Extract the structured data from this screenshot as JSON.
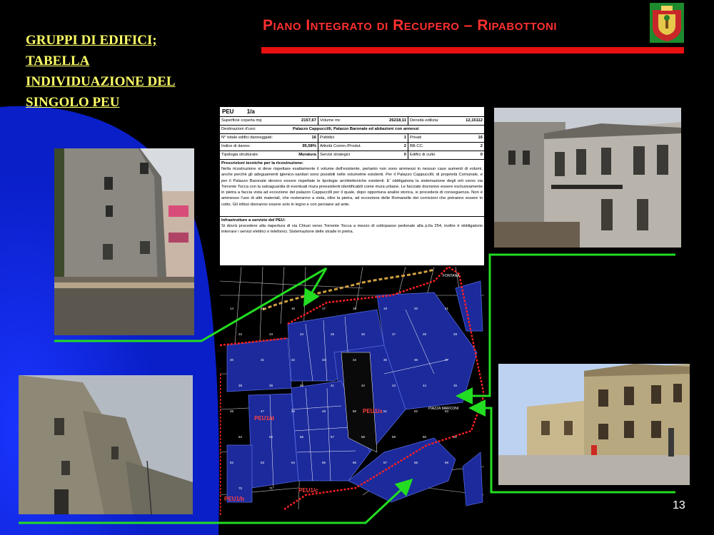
{
  "slide": {
    "title_lines": [
      "GRUPPI DI EDIFICI;",
      "TABELLA",
      "INDIVIDUAZIONE DEL",
      "SINGOLO PEU"
    ],
    "main_title": "Piano Integrato di Recupero – Ripabottoni",
    "page_number": "13",
    "colors": {
      "accent_red": "#e81010",
      "title_yellow": "#ffff66",
      "arrow_green": "#22dd22",
      "background_blue": "#0a1fd8"
    }
  },
  "table": {
    "peu_label": "PEU",
    "peu_id": "1/a",
    "rows": [
      [
        [
          "Superficie coperta mq",
          "2157,67"
        ],
        [
          "Volume mc",
          "26218,11"
        ],
        [
          "Densità edilizia:",
          "12,15112"
        ]
      ],
      [
        [
          "Destinazioni d'uso:",
          "Palazzo Cappuccilli, Palazzo Baronale ed abitazioni con annessi"
        ]
      ],
      [
        [
          "N° totale edifici danneggiati:",
          "16"
        ],
        [
          "Pubblici",
          "1"
        ],
        [
          "Privati",
          "16"
        ]
      ],
      [
        [
          "Indice di danno:",
          "95,58%"
        ],
        [
          "Attività Comm./Produt.",
          "2"
        ],
        [
          "BB.CC.",
          "2"
        ]
      ],
      [
        [
          "Tipologia strutturale:",
          "Muratura"
        ],
        [
          "Servizi strategici",
          "0"
        ],
        [
          "Edifici di culto",
          "0"
        ]
      ]
    ],
    "prescrizioni_title": "Prescrizioni tecniche per la ricostruzione:",
    "prescrizioni_text": "Nella ricostruzione si deve rispettare esattamente il volume dell'esistente, pertanto non sono ammessi in nessun caso aumenti di volumi, anche perchè gli adeguamenti igienico-sanitari sono possibili nelle volumetrie esistenti. Per il Palazzo Cappuccilli, di proprietà Comunale, e per il Palazzo Baronale devono essere rispettate le tipologie architettoniche esistenti. E' obbligatoria la sistemazione degli orti verso via Torrente Tocca con la salvaguardia di eventuali mura preesistenti identificabili come mura urbane. Le facciate dovranno essere esclusivamente in pietra a faccia vista ad eccezione del palazzo Cappuccilli per il quale, dopo opportuna analisi storica, si procederà di conseguenza. Non è ammesso l'uso di altri materiali, che resteranno a vista, oltre la pietra, ad eccezione delle Romanelle dei cornicioni che potranno essere in cotto. Gli infissi dovranno essere solo in legno e con persiane ad ante.",
    "infrastrutture_title": "Infrastrutture a servizio del PEU:",
    "infrastrutture_text": "Si dovrà procedere alla riapertura di via Chiusi verso Torrente Tocca a mezzo di sottopasso pedonale alla p.lla 254, inoltre è obbligatorio interrare i servizi elettrici e telefonici. Sistemazione delle strade in pietra."
  },
  "map": {
    "labels": [
      "PEU1/a",
      "PEU1/b",
      "PEU1/c",
      "PEU1/d",
      "PIAZZA MARCONI",
      "FONTANA"
    ],
    "parcels": [
      "14",
      "15",
      "16",
      "17",
      "18",
      "19",
      "20",
      "21",
      "22",
      "23",
      "24",
      "25",
      "26",
      "27",
      "28",
      "29",
      "30",
      "31",
      "32",
      "33",
      "34",
      "35",
      "36",
      "37",
      "38",
      "39",
      "40",
      "41",
      "42",
      "43",
      "44",
      "45",
      "46",
      "47",
      "48",
      "49",
      "50",
      "51",
      "52",
      "53",
      "54",
      "55",
      "56",
      "57",
      "58",
      "59",
      "60",
      "61",
      "62",
      "63",
      "64",
      "65",
      "66",
      "67",
      "68",
      "69",
      "70",
      "71"
    ]
  }
}
